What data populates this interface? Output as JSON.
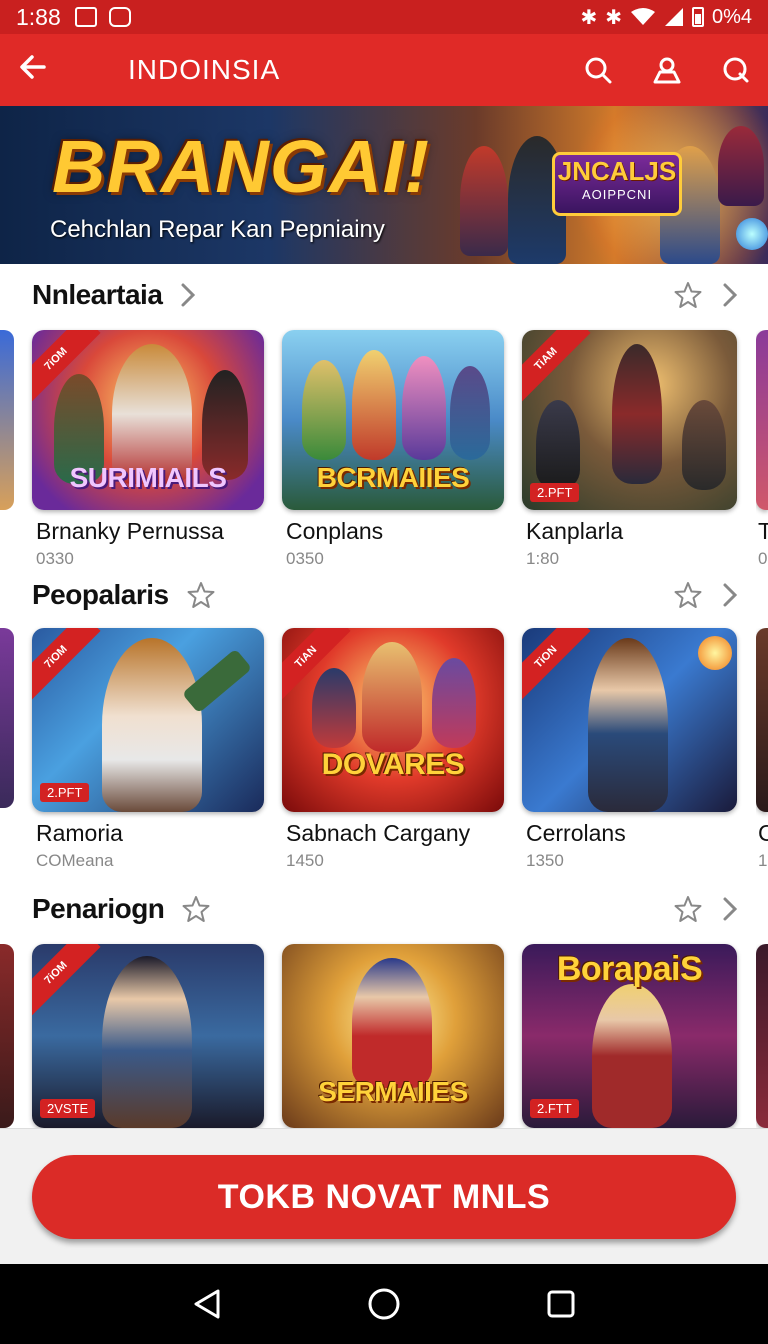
{
  "status_bar": {
    "time": "1:88",
    "battery": "0%4",
    "icons": [
      "gallery-icon",
      "edit-icon",
      "bluetooth-icon",
      "wifi-icon",
      "signal-icon",
      "battery-icon"
    ]
  },
  "app_bar": {
    "title": "INDOINSIA",
    "icons": [
      "back-arrow-icon",
      "search-icon",
      "profile-icon",
      "search-icon"
    ]
  },
  "banner": {
    "headline": "BRANGAI!",
    "tagline": "Cehchlan Repar Kan Pepniainy",
    "badge_title": "JNCALJS",
    "badge_subtitle": "AOIPPCNI"
  },
  "sections": [
    {
      "title": "Nnleartaia",
      "cards": [
        {
          "name": "Brnanky Pernussa",
          "meta": "0330",
          "ribbon": "7iOM",
          "logo": "SURIMIAILS",
          "tag": ""
        },
        {
          "name": "Conplans",
          "meta": "0350",
          "ribbon": "",
          "logo": "BCRMAIIES",
          "tag": ""
        },
        {
          "name": "Kanplarla",
          "meta": "1:80",
          "ribbon": "TiAM",
          "logo": "",
          "tag": "2.PFT"
        }
      ],
      "peek_right": "T",
      "peek_right_meta": "0"
    },
    {
      "title": "Peopalaris",
      "cards": [
        {
          "name": "Ramoria",
          "meta": "COMeana",
          "ribbon": "7iOM",
          "logo": "",
          "tag": "2.PFT"
        },
        {
          "name": "Sabnach Cargany",
          "meta": "1450",
          "ribbon": "TiAN",
          "logo": "DOVARES",
          "tag": ""
        },
        {
          "name": "Cerrolans",
          "meta": "1350",
          "ribbon": "TiON",
          "logo": "",
          "tag": ""
        }
      ],
      "peek_right": "C",
      "peek_right_meta": "1"
    },
    {
      "title": "Penariogn",
      "cards": [
        {
          "name": "",
          "meta": "",
          "ribbon": "7iOM",
          "logo": "",
          "tag": "2VSTE"
        },
        {
          "name": "",
          "meta": "",
          "ribbon": "",
          "logo": "SERMAIIES",
          "tag": ""
        },
        {
          "name": "",
          "meta": "",
          "ribbon": "",
          "logo": "BorapaiS",
          "tag": "2.FTT"
        }
      ]
    }
  ],
  "cta": {
    "label": "TOKB NOVAT MNLS"
  },
  "nav": {
    "icons": [
      "nav-back-icon",
      "nav-home-icon",
      "nav-recents-icon"
    ]
  },
  "colors": {
    "brand_red": "#e02a27",
    "status_red": "#c9201f",
    "cta_red": "#db2b27",
    "banner_gold": "#ffc933"
  }
}
